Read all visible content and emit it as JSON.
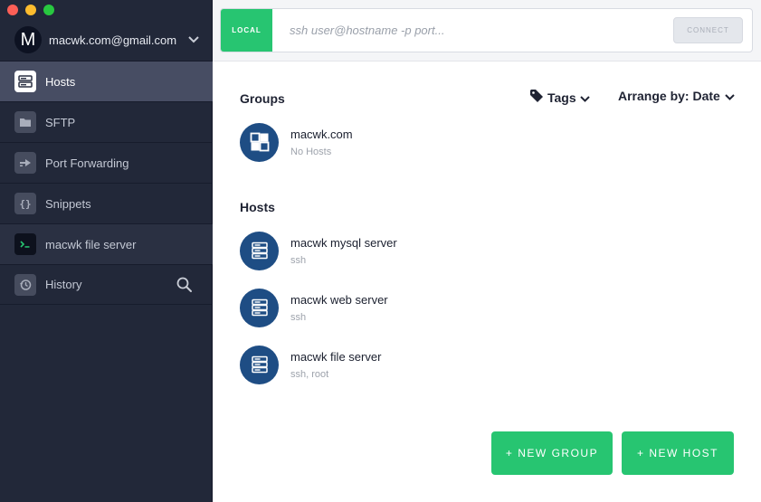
{
  "account": {
    "initial": "M",
    "email": "macwk.com@gmail.com"
  },
  "sidebar": {
    "items": [
      {
        "label": "Hosts"
      },
      {
        "label": "SFTP"
      },
      {
        "label": "Port Forwarding"
      },
      {
        "label": "Snippets"
      },
      {
        "label": "macwk file server"
      },
      {
        "label": "History"
      }
    ]
  },
  "connect": {
    "local_tag": "LOCAL",
    "placeholder": "ssh user@hostname -p port...",
    "value": "",
    "button_label": "CONNECT"
  },
  "main": {
    "groups_title": "Groups",
    "hosts_title": "Hosts",
    "tags_label": "Tags",
    "arrange_label": "Arrange by: Date",
    "groups": [
      {
        "name": "macwk.com",
        "sub": "No Hosts"
      }
    ],
    "hosts": [
      {
        "name": "macwk mysql server",
        "sub": "ssh"
      },
      {
        "name": "macwk web server",
        "sub": "ssh"
      },
      {
        "name": "macwk file server",
        "sub": "ssh, root"
      }
    ],
    "new_group_label": "+ NEW GROUP",
    "new_host_label": "+ NEW HOST"
  },
  "colors": {
    "accent_green": "#27c571",
    "host_icon_blue": "#1e4d84",
    "sidebar_bg": "#222839"
  },
  "icons": [
    "hosts-icon",
    "sftp-folder-icon",
    "port-forwarding-icon",
    "snippets-braces-icon",
    "terminal-icon",
    "history-icon",
    "search-icon",
    "tag-icon",
    "chevron-down-icon",
    "group-icon",
    "server-icon"
  ]
}
